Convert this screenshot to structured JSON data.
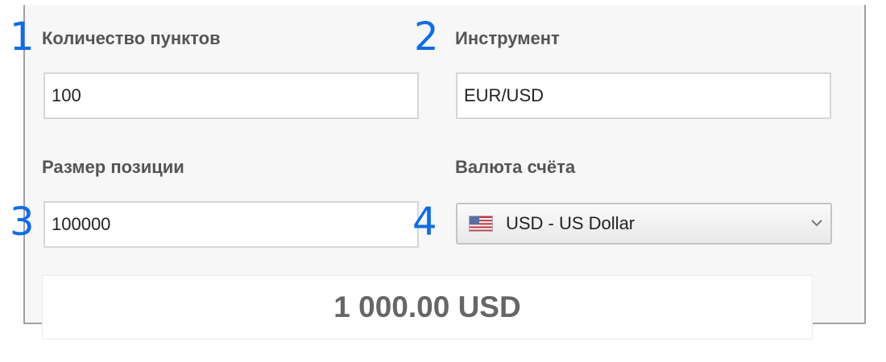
{
  "steps": {
    "one": "1",
    "two": "2",
    "three": "3",
    "four": "4"
  },
  "pips": {
    "label": "Количество пунктов",
    "value": "100"
  },
  "instrument": {
    "label": "Инструмент",
    "value": "EUR/USD"
  },
  "position_size": {
    "label": "Размер позиции",
    "value": "100000"
  },
  "account_currency": {
    "label": "Валюта счёта",
    "selected": "USD - US Dollar",
    "flag_icon": "us-flag-icon"
  },
  "result": {
    "value": "1 000.00 USD"
  },
  "colors": {
    "step_accent": "#0a6cf0",
    "label_text": "#555555",
    "result_text": "#666666"
  }
}
